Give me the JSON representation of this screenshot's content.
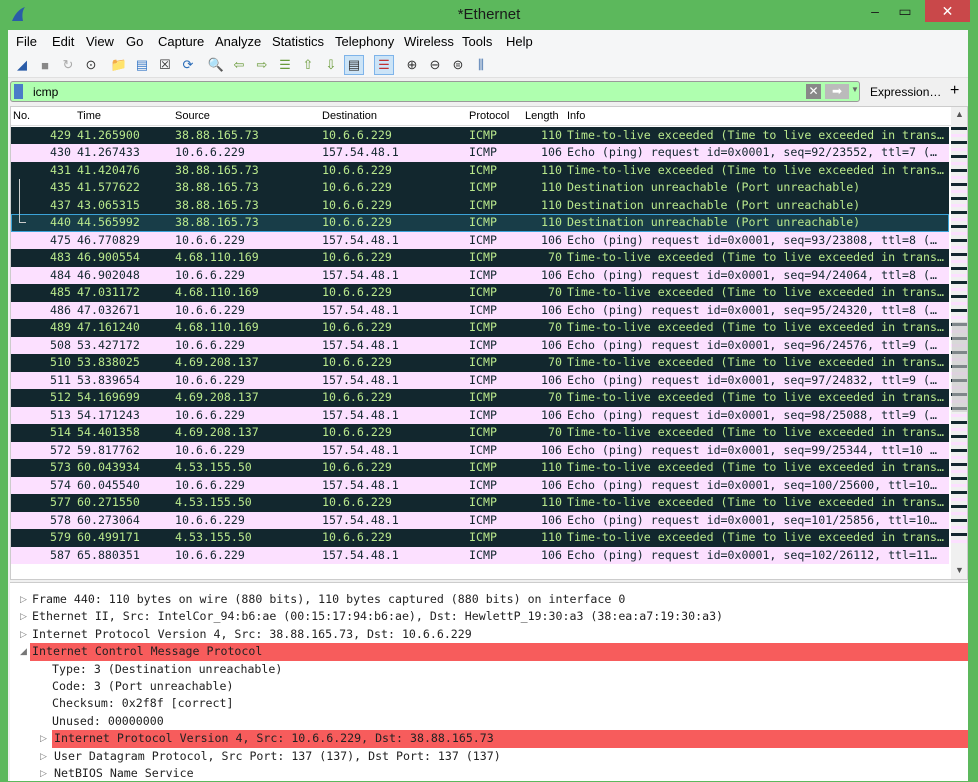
{
  "window": {
    "title": "*Ethernet",
    "minimize": "–",
    "maximize": "▭",
    "close": "✕"
  },
  "menu": [
    "File",
    "Edit",
    "View",
    "Go",
    "Capture",
    "Analyze",
    "Statistics",
    "Telephony",
    "Wireless",
    "Tools",
    "Help"
  ],
  "toolbar": [
    "shark-fin-start-icon",
    "stop-icon",
    "restart-icon",
    "options-gear-icon",
    "open-folder-icon",
    "save-file-icon",
    "close-file-icon",
    "reload-icon",
    "find-icon",
    "back-arrow-icon",
    "forward-arrow-icon",
    "go-to-packet-icon",
    "first-packet-icon",
    "last-packet-icon",
    "autoscroll-icon",
    "colorize-icon",
    "zoom-in-icon",
    "zoom-out-icon",
    "normal-size-icon",
    "resize-columns-icon"
  ],
  "filter": {
    "value": "icmp",
    "expression_label": "Expression…",
    "add_label": "+"
  },
  "columns": [
    "No.",
    "Time",
    "Source",
    "Destination",
    "Protocol",
    "Length",
    "Info"
  ],
  "colors": {
    "dark_bg": "#12272e",
    "dark_fg": "#b9e88c",
    "pink_bg": "#fce0ff",
    "highlight": "#f75c5c",
    "window": "#5cb85c"
  },
  "packets": [
    [
      "429",
      "41.265900",
      "38.88.165.73",
      "10.6.6.229",
      "ICMP",
      "110",
      "Time-to-live exceeded (Time to live exceeded in trans…",
      "dark"
    ],
    [
      "430",
      "41.267433",
      "10.6.6.229",
      "157.54.48.1",
      "ICMP",
      "106",
      "Echo (ping) request  id=0x0001, seq=92/23552, ttl=7 (…",
      "pink"
    ],
    [
      "431",
      "41.420476",
      "38.88.165.73",
      "10.6.6.229",
      "ICMP",
      "110",
      "Time-to-live exceeded (Time to live exceeded in trans…",
      "dark"
    ],
    [
      "435",
      "41.577622",
      "38.88.165.73",
      "10.6.6.229",
      "ICMP",
      "110",
      "Destination unreachable (Port unreachable)",
      "dark"
    ],
    [
      "437",
      "43.065315",
      "38.88.165.73",
      "10.6.6.229",
      "ICMP",
      "110",
      "Destination unreachable (Port unreachable)",
      "dark"
    ],
    [
      "440",
      "44.565992",
      "38.88.165.73",
      "10.6.6.229",
      "ICMP",
      "110",
      "Destination unreachable (Port unreachable)",
      "sel"
    ],
    [
      "475",
      "46.770829",
      "10.6.6.229",
      "157.54.48.1",
      "ICMP",
      "106",
      "Echo (ping) request  id=0x0001, seq=93/23808, ttl=8 (…",
      "pink"
    ],
    [
      "483",
      "46.900554",
      "4.68.110.169",
      "10.6.6.229",
      "ICMP",
      "70",
      "Time-to-live exceeded (Time to live exceeded in trans…",
      "dark"
    ],
    [
      "484",
      "46.902048",
      "10.6.6.229",
      "157.54.48.1",
      "ICMP",
      "106",
      "Echo (ping) request  id=0x0001, seq=94/24064, ttl=8 (…",
      "pink"
    ],
    [
      "485",
      "47.031172",
      "4.68.110.169",
      "10.6.6.229",
      "ICMP",
      "70",
      "Time-to-live exceeded (Time to live exceeded in trans…",
      "dark"
    ],
    [
      "486",
      "47.032671",
      "10.6.6.229",
      "157.54.48.1",
      "ICMP",
      "106",
      "Echo (ping) request  id=0x0001, seq=95/24320, ttl=8 (…",
      "pink"
    ],
    [
      "489",
      "47.161240",
      "4.68.110.169",
      "10.6.6.229",
      "ICMP",
      "70",
      "Time-to-live exceeded (Time to live exceeded in trans…",
      "dark"
    ],
    [
      "508",
      "53.427172",
      "10.6.6.229",
      "157.54.48.1",
      "ICMP",
      "106",
      "Echo (ping) request  id=0x0001, seq=96/24576, ttl=9 (…",
      "pink"
    ],
    [
      "510",
      "53.838025",
      "4.69.208.137",
      "10.6.6.229",
      "ICMP",
      "70",
      "Time-to-live exceeded (Time to live exceeded in trans…",
      "dark"
    ],
    [
      "511",
      "53.839654",
      "10.6.6.229",
      "157.54.48.1",
      "ICMP",
      "106",
      "Echo (ping) request  id=0x0001, seq=97/24832, ttl=9 (…",
      "pink"
    ],
    [
      "512",
      "54.169699",
      "4.69.208.137",
      "10.6.6.229",
      "ICMP",
      "70",
      "Time-to-live exceeded (Time to live exceeded in trans…",
      "dark"
    ],
    [
      "513",
      "54.171243",
      "10.6.6.229",
      "157.54.48.1",
      "ICMP",
      "106",
      "Echo (ping) request  id=0x0001, seq=98/25088, ttl=9 (…",
      "pink"
    ],
    [
      "514",
      "54.401358",
      "4.69.208.137",
      "10.6.6.229",
      "ICMP",
      "70",
      "Time-to-live exceeded (Time to live exceeded in trans…",
      "dark"
    ],
    [
      "572",
      "59.817762",
      "10.6.6.229",
      "157.54.48.1",
      "ICMP",
      "106",
      "Echo (ping) request  id=0x0001, seq=99/25344, ttl=10 …",
      "pink"
    ],
    [
      "573",
      "60.043934",
      "4.53.155.50",
      "10.6.6.229",
      "ICMP",
      "110",
      "Time-to-live exceeded (Time to live exceeded in trans…",
      "dark"
    ],
    [
      "574",
      "60.045540",
      "10.6.6.229",
      "157.54.48.1",
      "ICMP",
      "106",
      "Echo (ping) request  id=0x0001, seq=100/25600, ttl=10…",
      "pink"
    ],
    [
      "577",
      "60.271550",
      "4.53.155.50",
      "10.6.6.229",
      "ICMP",
      "110",
      "Time-to-live exceeded (Time to live exceeded in trans…",
      "dark"
    ],
    [
      "578",
      "60.273064",
      "10.6.6.229",
      "157.54.48.1",
      "ICMP",
      "106",
      "Echo (ping) request  id=0x0001, seq=101/25856, ttl=10…",
      "pink"
    ],
    [
      "579",
      "60.499171",
      "4.53.155.50",
      "10.6.6.229",
      "ICMP",
      "110",
      "Time-to-live exceeded (Time to live exceeded in trans…",
      "dark"
    ],
    [
      "587",
      "65.880351",
      "10.6.6.229",
      "157.54.48.1",
      "ICMP",
      "106",
      "Echo (ping) request  id=0x0001, seq=102/26112, ttl=11…",
      "pink"
    ]
  ],
  "details": [
    {
      "text": "Frame 440: 110 bytes on wire (880 bits), 110 bytes captured (880 bits) on interface 0",
      "level": 0,
      "arrow": "▷",
      "hl": false
    },
    {
      "text": "Ethernet II, Src: IntelCor_94:b6:ae (00:15:17:94:b6:ae), Dst: HewlettP_19:30:a3 (38:ea:a7:19:30:a3)",
      "level": 0,
      "arrow": "▷",
      "hl": false
    },
    {
      "text": "Internet Protocol Version 4, Src: 38.88.165.73, Dst: 10.6.6.229",
      "level": 0,
      "arrow": "▷",
      "hl": false
    },
    {
      "text": "Internet Control Message Protocol",
      "level": 0,
      "arrow": "◢",
      "hl": true
    },
    {
      "text": "Type: 3 (Destination unreachable)",
      "level": 1,
      "arrow": "",
      "hl": false
    },
    {
      "text": "Code: 3 (Port unreachable)",
      "level": 1,
      "arrow": "",
      "hl": false
    },
    {
      "text": "Checksum: 0x2f8f [correct]",
      "level": 1,
      "arrow": "",
      "hl": false
    },
    {
      "text": "Unused: 00000000",
      "level": 1,
      "arrow": "",
      "hl": false
    },
    {
      "text": "Internet Protocol Version 4, Src: 10.6.6.229, Dst: 38.88.165.73",
      "level": 1,
      "arrow": "▷",
      "hl": true
    },
    {
      "text": "User Datagram Protocol, Src Port: 137 (137), Dst Port: 137 (137)",
      "level": 1,
      "arrow": "▷",
      "hl": false
    },
    {
      "text": "NetBIOS Name Service",
      "level": 1,
      "arrow": "▷",
      "hl": false
    }
  ]
}
